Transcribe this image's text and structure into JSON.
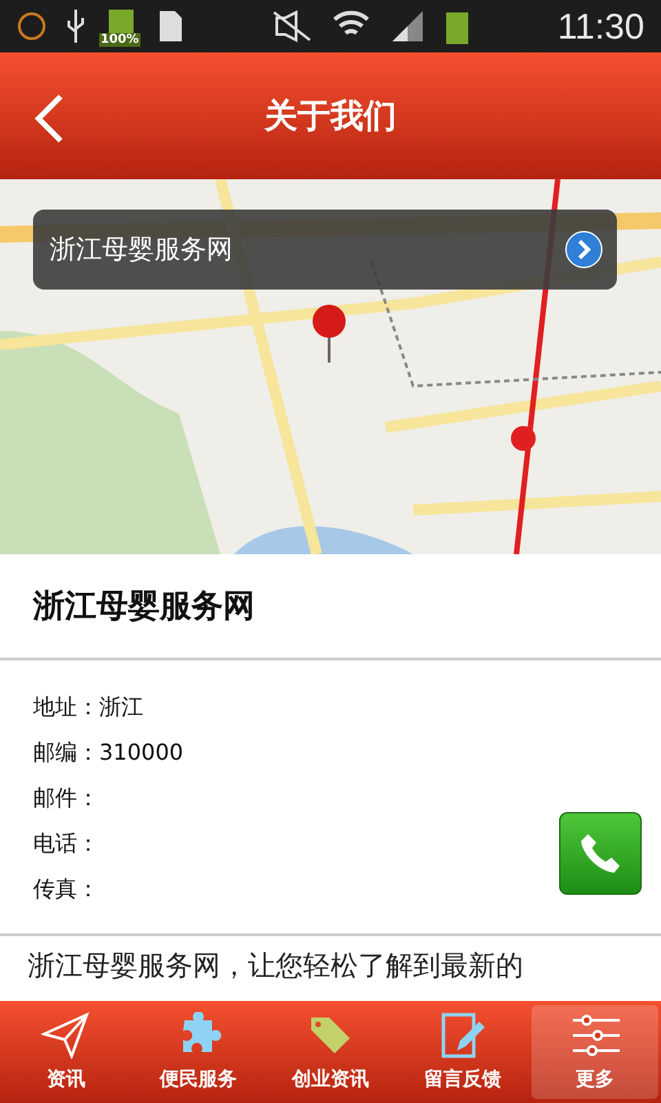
{
  "status_bar": {
    "battery_label": "100%",
    "time": "11:30"
  },
  "header": {
    "title": "关于我们"
  },
  "map": {
    "callout": "浙江母婴服务网"
  },
  "org": {
    "name": "浙江母婴服务网"
  },
  "details": [
    {
      "label": "地址：",
      "value": "浙江"
    },
    {
      "label": "邮编：",
      "value": "310000"
    },
    {
      "label": "邮件："
    },
    {
      "label": "电话："
    },
    {
      "label": "传真："
    }
  ],
  "intro": "浙江母婴服务网，让您轻松了解到最新的",
  "tabs": [
    {
      "label": "资讯",
      "kind": "plane",
      "selected": false
    },
    {
      "label": "便民服务",
      "kind": "puzzle",
      "selected": false
    },
    {
      "label": "创业资讯",
      "kind": "tag",
      "selected": false
    },
    {
      "label": "留言反馈",
      "kind": "edit",
      "selected": false
    },
    {
      "label": "更多",
      "kind": "sliders",
      "selected": true
    }
  ]
}
